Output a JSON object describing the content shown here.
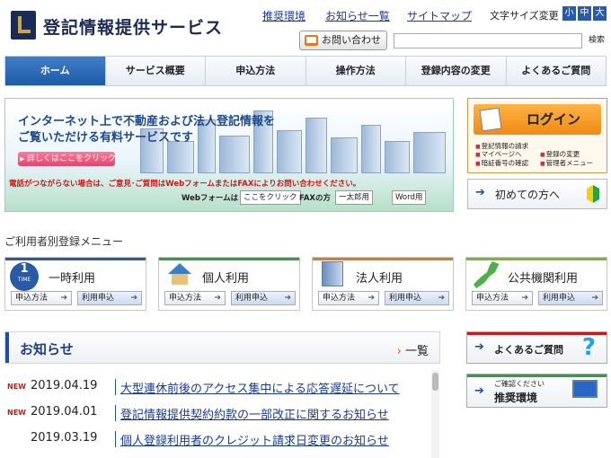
{
  "header": {
    "site_title": "登記情報提供サービス",
    "links": [
      "推奨環境",
      "お知らせ一覧",
      "サイトマップ"
    ],
    "font_size_label": "文字サイズ変更",
    "font_sizes": [
      "小",
      "中",
      "大"
    ],
    "contact_label": "お問い合わせ",
    "search_placeholder": "",
    "search_button": "検索"
  },
  "nav": {
    "items": [
      "ホーム",
      "サービス概要",
      "申込方法",
      "操作方法",
      "登録内容の変更",
      "よくあるご質問"
    ],
    "active_index": 0
  },
  "banner": {
    "headline_1": "インターネット上で不動産および法人登記情報を",
    "headline_2": "ご覧いただける有料サービスです",
    "click_label": "詳しくはここをクリック",
    "notice": "電話がつながらない場合は、ご意見･ご質問はWebフォームまたはFAXによりお問い合わせください。",
    "webform_label": "Webフォームは",
    "webform_button": "ここをクリック",
    "fax_label": "FAXの方",
    "ichitaro_button": "一太郎用",
    "word_button": "Word用"
  },
  "login": {
    "button_label": "ログイン",
    "links": [
      "登記情報の請求",
      "マイページへ",
      "登録の変更",
      "暗証番号の確認",
      "管理者メニュー"
    ]
  },
  "first_time": {
    "label": "初めての方へ"
  },
  "user_menu": {
    "title": "ご利用者別登録メニュー",
    "cards": [
      {
        "label": "一時利用",
        "icon_text": "1",
        "icon_sub": "TIME",
        "btn1": "申込方法",
        "btn2": "利用申込",
        "bar_color": "#2a5aa6"
      },
      {
        "label": "個人利用",
        "btn1": "申込方法",
        "btn2": "利用申込",
        "bar_color": "#2ea042"
      },
      {
        "label": "法人利用",
        "btn1": "申込方法",
        "btn2": "利用申込",
        "bar_color": "#e07a1f"
      },
      {
        "label": "公共機関利用",
        "btn1": "申込方法",
        "btn2": "利用申込",
        "bar_color": "#7ab82a"
      }
    ]
  },
  "news": {
    "title": "お知らせ",
    "all_label": "一覧",
    "items": [
      {
        "badge": "NEW",
        "date": "2019.04.19",
        "text": "大型連休前後のアクセス集中による応答遅延について"
      },
      {
        "badge": "NEW",
        "date": "2019.04.01",
        "text": "登記情報提供契約約款の一部改正に関するお知らせ"
      },
      {
        "badge": "",
        "date": "2019.03.19",
        "text": "個人登録利用者のクレジット請求日変更のお知らせ"
      }
    ]
  },
  "side": {
    "faq_label": "よくあるご質問",
    "env_small": "ご確認ください",
    "env_label": "推奨環境"
  },
  "colors": {
    "brand": "#1c2a56",
    "nav_active": "#1f5ba8",
    "login_orange": "#f08a14",
    "alert_red": "#d01616"
  }
}
